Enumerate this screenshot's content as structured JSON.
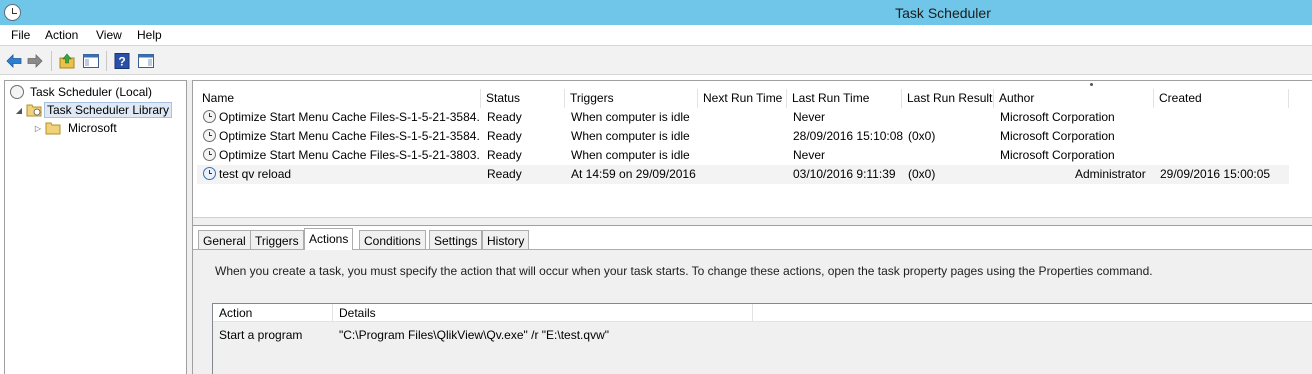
{
  "window": {
    "title": "Task Scheduler"
  },
  "menu": [
    "File",
    "Action",
    "View",
    "Help"
  ],
  "toolbar": {
    "icons": [
      "back-arrow-icon",
      "forward-arrow-icon",
      "up-folder-icon",
      "show-hide-console-tree-icon",
      "help-icon",
      "show-hide-action-pane-icon"
    ]
  },
  "tree": {
    "root": "Task Scheduler (Local)",
    "library": "Task Scheduler Library",
    "folder": "Microsoft",
    "expander_open": "◢",
    "expander_closed": "▷"
  },
  "tasks": {
    "columns": [
      "Name",
      "Status",
      "Triggers",
      "Next Run Time",
      "Last Run Time",
      "Last Run Result",
      "Author",
      "Created"
    ],
    "rows": [
      {
        "name": "Optimize Start Menu Cache Files-S-1-5-21-3584...",
        "status": "Ready",
        "triggers": "When computer is idle",
        "next_run": "",
        "last_run": "Never",
        "result": "",
        "author": "Microsoft Corporation",
        "created": ""
      },
      {
        "name": "Optimize Start Menu Cache Files-S-1-5-21-3584...",
        "status": "Ready",
        "triggers": "When computer is idle",
        "next_run": "",
        "last_run": "28/09/2016 15:10:08",
        "result": "(0x0)",
        "author": "Microsoft Corporation",
        "created": ""
      },
      {
        "name": "Optimize Start Menu Cache Files-S-1-5-21-3803...",
        "status": "Ready",
        "triggers": "When computer is idle",
        "next_run": "",
        "last_run": "Never",
        "result": "",
        "author": "Microsoft Corporation",
        "created": ""
      },
      {
        "name": "test qv reload",
        "status": "Ready",
        "triggers": "At 14:59 on 29/09/2016",
        "next_run": "",
        "last_run": "03/10/2016 9:11:39",
        "result": "(0x0)",
        "author": "Administrator",
        "created": "29/09/2016 15:00:05"
      }
    ]
  },
  "detail": {
    "tabs": [
      "General",
      "Triggers",
      "Actions",
      "Conditions",
      "Settings",
      "History"
    ],
    "active_tab": "Actions",
    "description": "When you create a task, you must specify the action that will occur when your task starts.  To change these actions, open the task property pages using the Properties command.",
    "actions_header": [
      "Action",
      "Details"
    ],
    "actions_rows": [
      {
        "action": "Start a program",
        "details": "\"C:\\Program Files\\QlikView\\Qv.exe\" /r \"E:\\test.qvw\""
      }
    ]
  },
  "colors": {
    "titlebar": "#6fc6e8",
    "selection": "#dfe9f5",
    "row_highlight": "#f3f3f3"
  }
}
